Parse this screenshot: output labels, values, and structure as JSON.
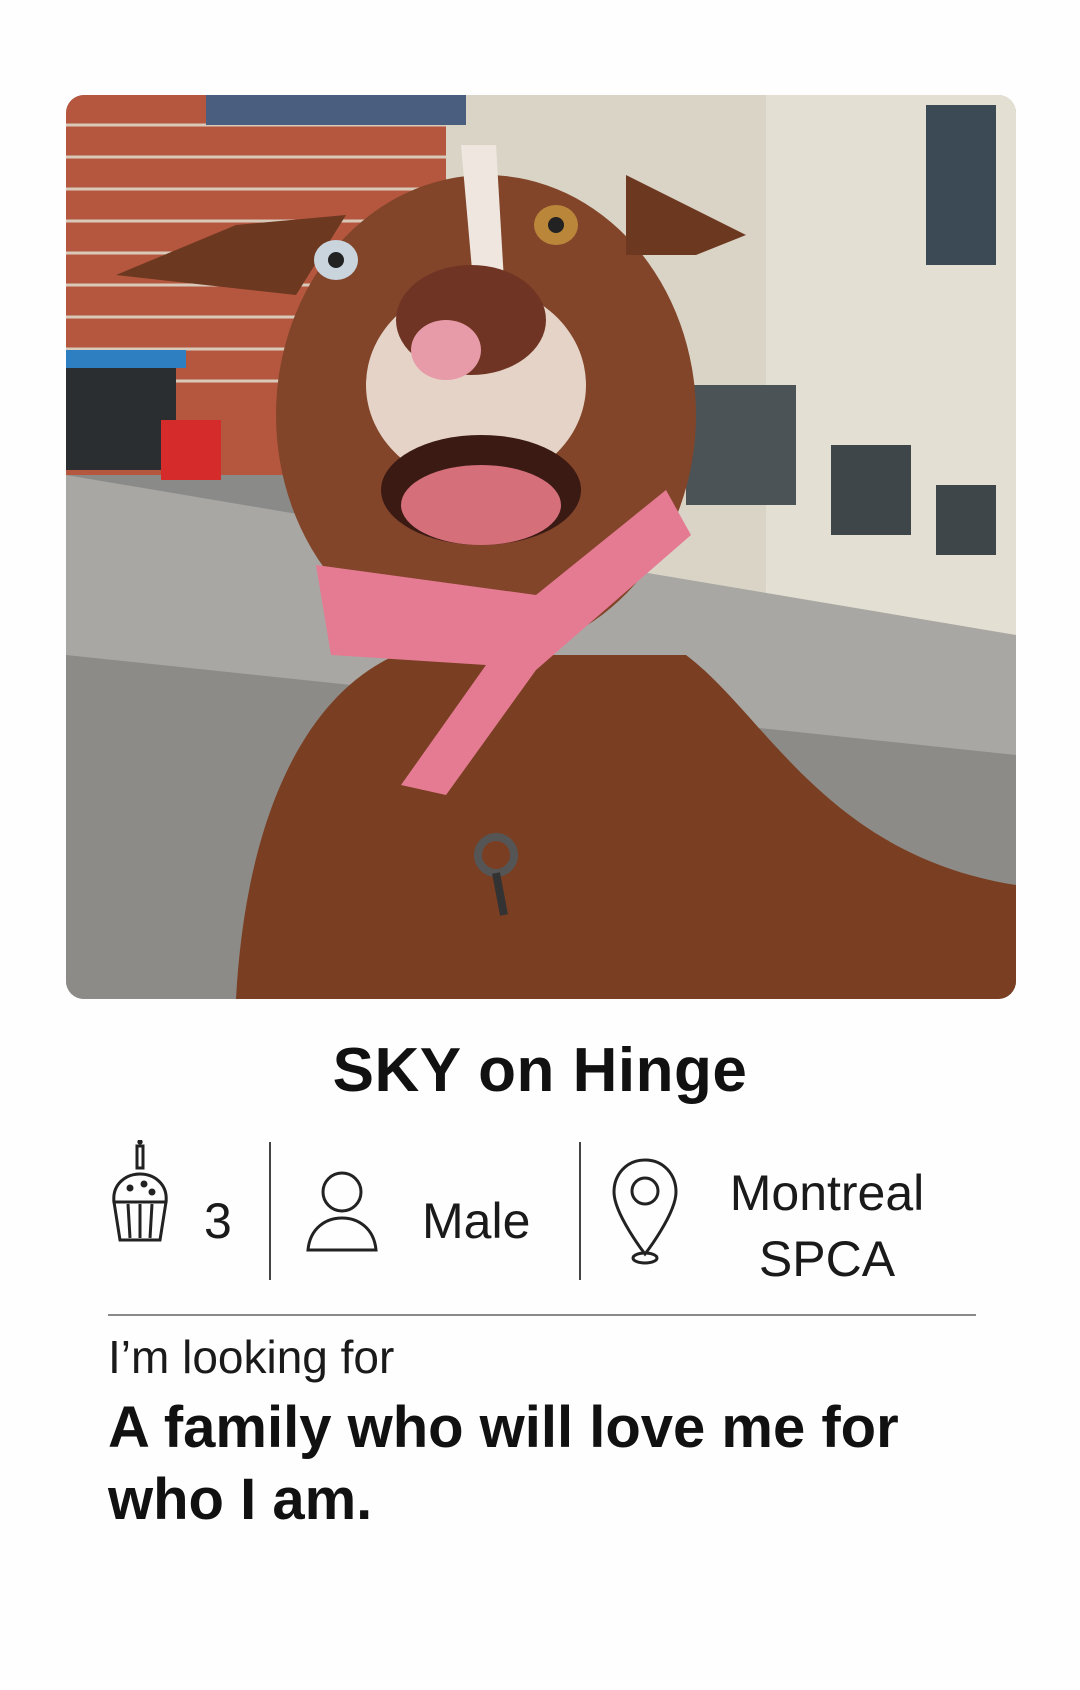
{
  "profile": {
    "title": "SKY on Hinge",
    "age": "3",
    "gender": "Male",
    "location_line1": "Montreal",
    "location_line2": "SPCA"
  },
  "prompt": {
    "label": "I’m looking for",
    "answer": "A family who will love me for who I am."
  },
  "icons": {
    "age": "birthday-cupcake-icon",
    "gender": "person-icon",
    "location": "map-pin-icon"
  },
  "colors": {
    "text": "#111111",
    "divider": "#8a8a8a",
    "background": "#fefefe",
    "harness": "#e57b93"
  }
}
